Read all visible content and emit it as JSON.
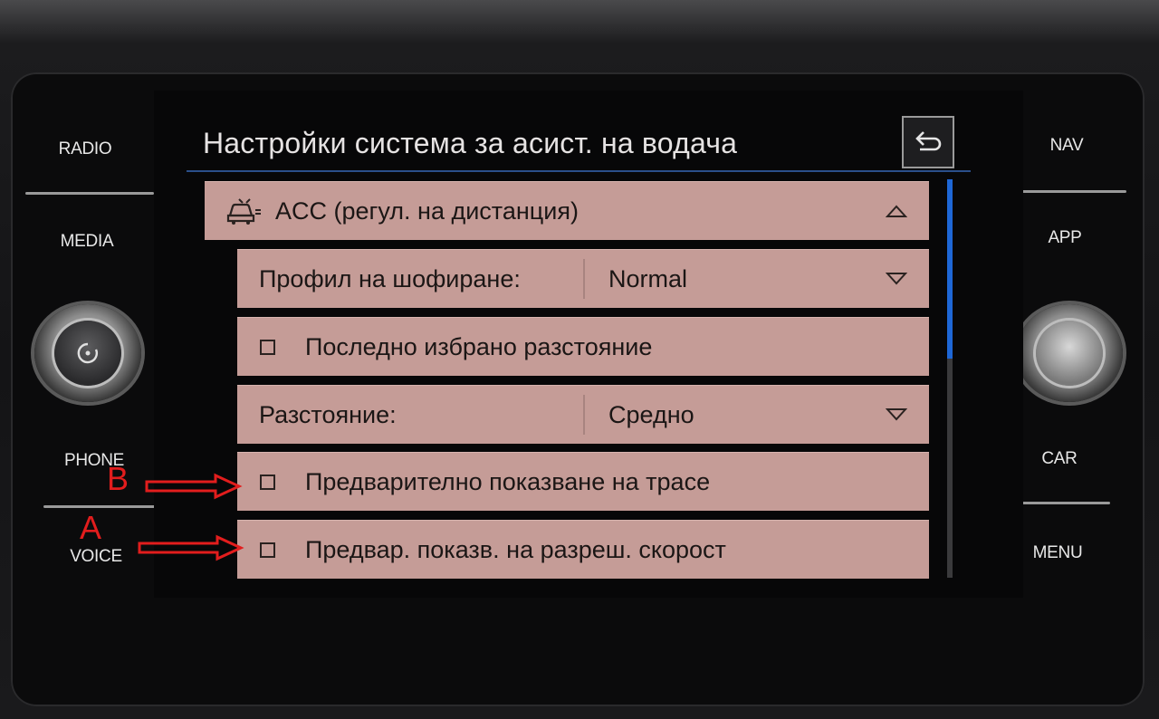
{
  "hardware": {
    "left_buttons": [
      {
        "label": "RADIO"
      },
      {
        "label": "MEDIA"
      },
      {
        "label": "PHONE"
      },
      {
        "label": "VOICE"
      }
    ],
    "right_buttons": [
      {
        "label": "NAV"
      },
      {
        "label": "APP"
      },
      {
        "label": "CAR"
      },
      {
        "label": "MENU"
      }
    ]
  },
  "screen": {
    "title": "Настройки система за асист. на водача",
    "section": {
      "label": "ACC (регул. на дистанция)",
      "icon": "acc-car-icon",
      "expanded": true
    },
    "rows": [
      {
        "type": "dropdown",
        "label": "Профил на шофиране:",
        "value": "Normal"
      },
      {
        "type": "checkbox",
        "label": "Последно избрано разстояние",
        "checked": false
      },
      {
        "type": "dropdown",
        "label": "Разстояние:",
        "value": "Средно"
      },
      {
        "type": "checkbox",
        "label": "Предварително показване на трасе",
        "checked": false
      },
      {
        "type": "checkbox",
        "label": "Предвар. показв. на разреш. скорост",
        "checked": false
      }
    ],
    "scroll_position_fraction": 0.0,
    "scroll_visible_fraction": 0.45
  },
  "annotations": {
    "letter_b": "B",
    "letter_a": "A"
  },
  "colors": {
    "row_bg": "#c59c97",
    "accent_blue": "#1e67d6",
    "annotation_red": "#e21d1d"
  }
}
